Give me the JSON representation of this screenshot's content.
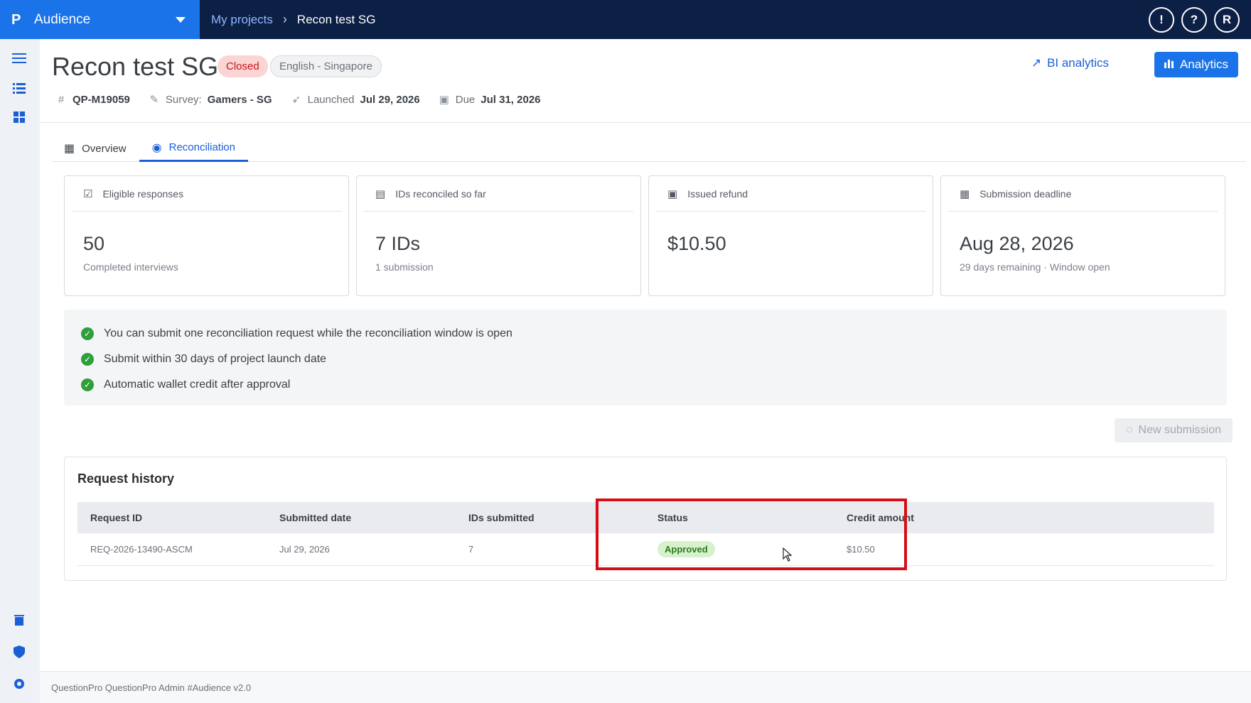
{
  "brand": {
    "name": "Audience",
    "logo": "P"
  },
  "breadcrumb": {
    "parent": "My projects",
    "current": "Recon test SG"
  },
  "top_actions": {
    "feedback_icon": "!",
    "help_icon": "?",
    "avatar_initial": "R"
  },
  "project": {
    "title": "Recon test SG",
    "status": "Closed",
    "language": "English - Singapore",
    "id": "QP-M19059",
    "survey_label": "Survey:",
    "survey": "Gamers - SG",
    "launched_label": "Launched",
    "launched": "Jul 29, 2026",
    "due_label": "Due",
    "due": "Jul 31, 2026"
  },
  "header_actions": {
    "bi_analytics": "BI analytics",
    "analytics": "Analytics"
  },
  "tabs": [
    {
      "label": "Overview"
    },
    {
      "label": "Reconciliation"
    }
  ],
  "cards": [
    {
      "title": "Eligible responses",
      "value": "50",
      "sub": "Completed interviews"
    },
    {
      "title": "IDs reconciled so far",
      "value": "7 IDs",
      "sub": "1 submission"
    },
    {
      "title": "Issued refund",
      "value": "$10.50",
      "sub": ""
    },
    {
      "title": "Submission deadline",
      "value": "Aug 28, 2026",
      "sub": "29 days remaining · Window open"
    }
  ],
  "info": [
    "You can submit one reconciliation request while the reconciliation window is open",
    "Submit within 30 days of project launch date",
    "Automatic wallet credit after approval"
  ],
  "new_submission": "New submission",
  "history": {
    "title": "Request history",
    "columns": [
      "Request ID",
      "Submitted date",
      "IDs submitted",
      "Status",
      "Credit amount"
    ],
    "rows": [
      {
        "id": "REQ-2026-13490-ASCM",
        "date": "Jul 29, 2026",
        "ids": "7",
        "status": "Approved",
        "credit": "$10.50"
      }
    ]
  },
  "footer": "QuestionPro QuestionPro Admin  #Audience v2.0",
  "colors": {
    "accent": "#1a73e8",
    "topbar": "#0c1f44",
    "approved": "#2c7a20",
    "closed": "#c5161d",
    "highlight": "#d60d15"
  }
}
